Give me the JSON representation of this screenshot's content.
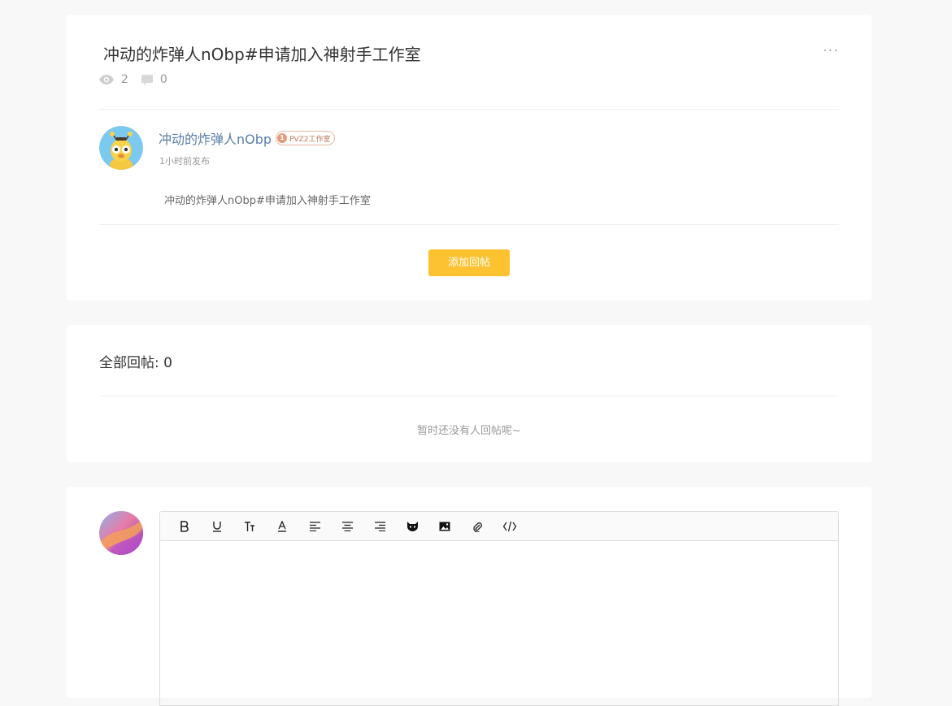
{
  "post": {
    "title": "冲动的炸弹人nObp#申请加入神射手工作室",
    "more_label": "···",
    "views": "2",
    "comments": "0",
    "author": {
      "name": "冲动的炸弹人nObp",
      "badge_level": "1",
      "badge_text": "PVZ2工作室",
      "time": "1小时前发布"
    },
    "content": "冲动的炸弹人nObp#申请加入神射手工作室",
    "reply_button": "添加回帖"
  },
  "replies": {
    "header": "全部回帖: 0",
    "empty_text": "暂时还没有人回帖呢~"
  },
  "editor": {
    "toolbar": [
      "bold-icon",
      "underline-icon",
      "font-size-icon",
      "font-color-icon",
      "align-left-icon",
      "align-center-icon",
      "align-right-icon",
      "emoji-cat-icon",
      "image-icon",
      "attachment-icon",
      "code-icon"
    ],
    "accent_color": "#fcc22f",
    "link_color": "#5a80a8"
  }
}
